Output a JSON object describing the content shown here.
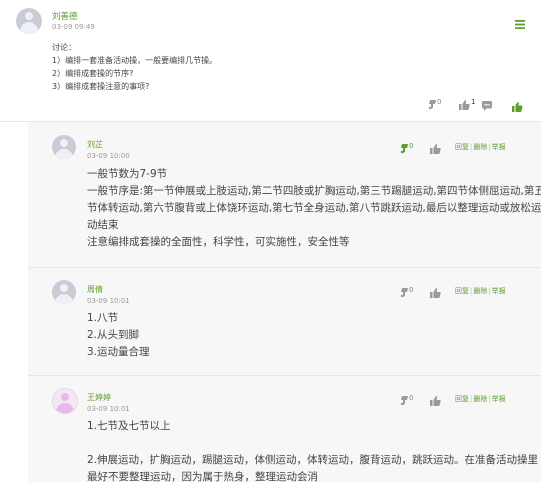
{
  "post": {
    "author": "刘善德",
    "time": "03-09 09:49",
    "heading": "讨论：",
    "questions": [
      "1）编排一套准备活动操，一般要编排几节操。",
      "2）编排成套操的节序?",
      "3）编排成套操注意的事项?"
    ],
    "dislike_count": "0",
    "like_count": "1"
  },
  "actions": {
    "reply": "回复",
    "delete": "删除",
    "report": "举报"
  },
  "replies": [
    {
      "author": "刘芷",
      "time": "03-09 10:00",
      "score": "0",
      "lines": [
        "一般节数为7-9节",
        "一般节序是:第一节伸展或上肢运动,第二节四肢或扩胸运动,第三节踢腿运动,第四节体侧屈运动,第五",
        "节体转运动,第六节腹背或上体饶环运动,第七节全身运动,第八节跳跃运动,最后以整理运动或放松运",
        "动结束",
        "注意编排成套操的全面性，科学性，可实施性，安全性等"
      ]
    },
    {
      "author": "周倩",
      "time": "03-09 10:01",
      "score": "0",
      "lines": [
        "1.八节",
        "2.从头到脚",
        "3.运动量合理"
      ]
    },
    {
      "author": "王婷婷",
      "time": "03-09 10:01",
      "score": "0",
      "lines": [
        "1.七节及七节以上",
        "",
        "2.伸展运动，扩胸运动，踢腿运动，体侧运动，体转运动，腹背运动，跳跃运动。在准备活动操里",
        "最好不要整理运动，因为属于热身，整理运动会消"
      ]
    }
  ],
  "colors": {
    "accent": "#5e9d2f",
    "icon_gray": "#9a9a9a",
    "divider": "#e6e6e6"
  },
  "icons": [
    "menu-icon",
    "dislike-icon",
    "like-icon",
    "comment-icon",
    "reply-icon"
  ]
}
